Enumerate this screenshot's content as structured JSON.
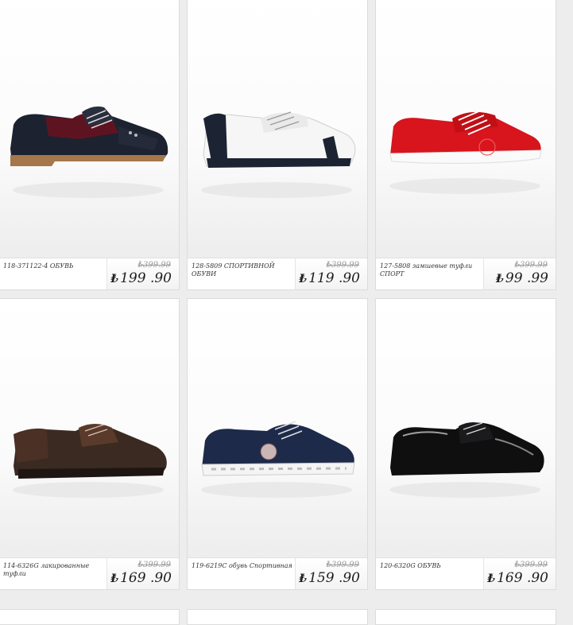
{
  "products": [
    {
      "name": "118-371122-4 ОБУВЬ",
      "old_price": "₺399.99",
      "currency": "₺",
      "price": "199 .90",
      "color": "burgundy-black-brogue"
    },
    {
      "name": "128-5809 СПОРТИВНОЙ ОБУВИ",
      "old_price": "₺399.99",
      "currency": "₺",
      "price": "119 .90",
      "color": "white-navy-sneaker"
    },
    {
      "name": "127-5808 замшевые туфли СПОРТ",
      "old_price": "₺399.99",
      "currency": "₺",
      "price": "99 .99",
      "color": "red-suede-sneaker"
    },
    {
      "name": "114-6326G лакированные туфли",
      "old_price": "₺399.99",
      "currency": "₺",
      "price": "169 .90",
      "color": "brown-patent-derby"
    },
    {
      "name": "119-6219C обувь Спортивная",
      "old_price": "₺399.99",
      "currency": "₺",
      "price": "159 .90",
      "color": "navy-suede-sneaker"
    },
    {
      "name": "120-6320G ОБУВЬ",
      "old_price": "₺399.99",
      "currency": "₺",
      "price": "169 .90",
      "color": "black-patent-oxford"
    }
  ]
}
